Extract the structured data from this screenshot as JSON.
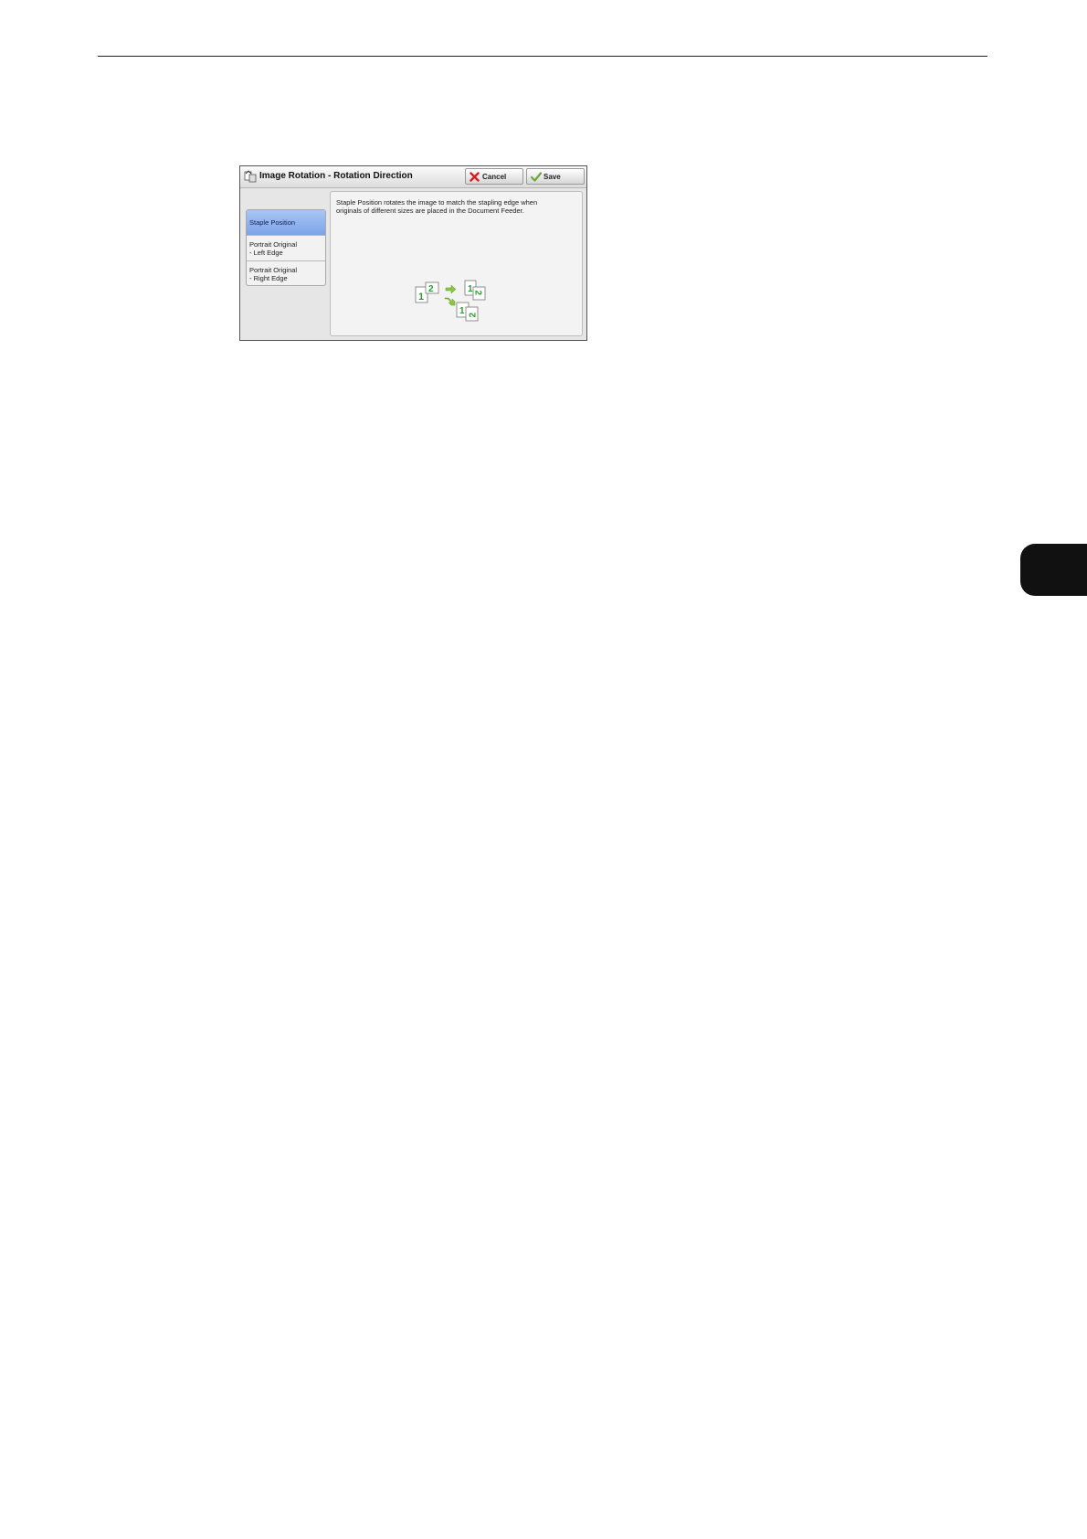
{
  "dialog": {
    "title": "Image Rotation - Rotation Direction",
    "cancel_label": "Cancel",
    "save_label": "Save",
    "options": [
      {
        "line1": "Staple Position",
        "line2": "",
        "selected": true
      },
      {
        "line1": "Portrait Original",
        "line2": "- Left Edge",
        "selected": false
      },
      {
        "line1": "Portrait Original",
        "line2": "- Right Edge",
        "selected": false
      }
    ],
    "description_line1": "Staple Position rotates the image to match the stapling edge when",
    "description_line2": "originals of different sizes are placed in the Document Feeder."
  },
  "illustration": {
    "page_numbers": [
      "1",
      "2"
    ],
    "accent_color": "#2e9a2e"
  }
}
